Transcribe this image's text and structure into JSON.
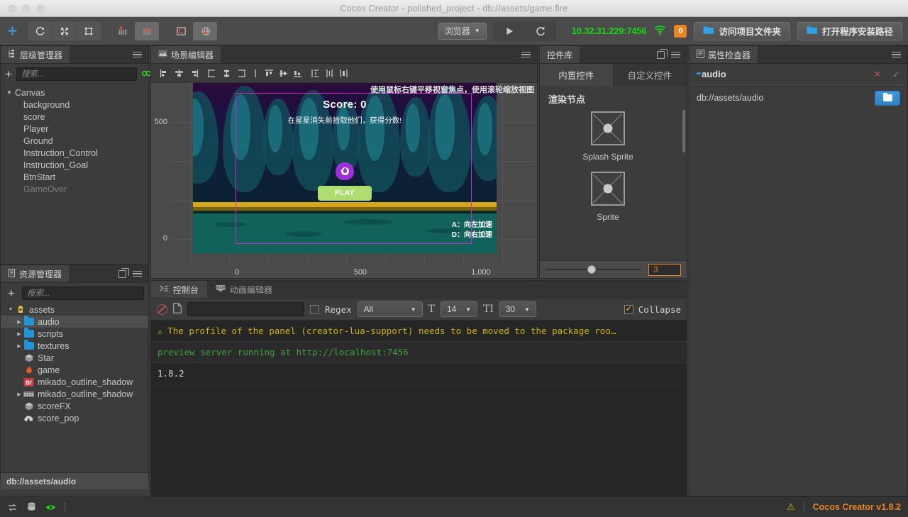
{
  "window": {
    "title": "Cocos Creator - polished_project - db://assets/game.fire"
  },
  "toolbar": {
    "tools": [
      {
        "name": "move-tool",
        "glyph": "✥"
      },
      {
        "name": "rotate-tool",
        "glyph": "⟳"
      },
      {
        "name": "scale-tool",
        "glyph": "✕"
      },
      {
        "name": "rect-tool",
        "glyph": "▣"
      }
    ],
    "view_tools": [
      {
        "name": "gizmo-position-tool",
        "glyph": "▦"
      },
      {
        "name": "gizmo-center-tool",
        "glyph": "✛"
      },
      {
        "name": "coord-local-tool",
        "glyph": "⌐"
      },
      {
        "name": "coord-global-tool",
        "glyph": "◍"
      }
    ],
    "browser_select": "浏览器",
    "browser_caret": "▼",
    "play_button": "▶",
    "refresh_button": "⟳",
    "ip_address": "10.32.31.229:7456",
    "wifi_icon": "wifi-icon",
    "notification_count": "0",
    "open_project_folder": "访问项目文件夹",
    "open_install_path": "打开程序安装路径"
  },
  "hierarchy": {
    "tab_label": "层级管理器",
    "search_placeholder": "搜索...",
    "root": "Canvas",
    "nodes": [
      {
        "label": "background",
        "dim": false
      },
      {
        "label": "score",
        "dim": false
      },
      {
        "label": "Player",
        "dim": false
      },
      {
        "label": "Ground",
        "dim": false
      },
      {
        "label": "Instruction_Control",
        "dim": false
      },
      {
        "label": "Instruction_Goal",
        "dim": false
      },
      {
        "label": "BtnStart",
        "dim": false
      },
      {
        "label": "GameOver",
        "dim": true
      }
    ]
  },
  "assets": {
    "tab_label": "资源管理器",
    "search_placeholder": "搜索...",
    "root": "assets",
    "items": [
      {
        "label": "audio",
        "icon": "folder",
        "arrow": "▶",
        "indent": 20,
        "selected": true
      },
      {
        "label": "scripts",
        "icon": "folder",
        "arrow": "▶",
        "indent": 20,
        "selected": false
      },
      {
        "label": "textures",
        "icon": "folder",
        "arrow": "▶",
        "indent": 20,
        "selected": false
      },
      {
        "label": "Star",
        "icon": "prefab",
        "arrow": "",
        "indent": 32,
        "selected": false
      },
      {
        "label": "game",
        "icon": "fire",
        "arrow": "",
        "indent": 32,
        "selected": false
      },
      {
        "label": "mikado_outline_shadow",
        "icon": "bitmap",
        "arrow": "",
        "indent": 32,
        "selected": false
      },
      {
        "label": "mikado_outline_shadow",
        "icon": "texture",
        "arrow": "▶",
        "indent": 20,
        "selected": false
      },
      {
        "label": "scoreFX",
        "icon": "prefab",
        "arrow": "",
        "indent": 32,
        "selected": false
      },
      {
        "label": "score_pop",
        "icon": "anim",
        "arrow": "",
        "indent": 32,
        "selected": false
      }
    ],
    "path_label": "db://assets/audio"
  },
  "scene": {
    "tab_label": "场景编辑器",
    "align_tools": [
      "align-left-icon",
      "align-hcenter-icon",
      "align-right-icon",
      "dist-left-icon",
      "dist-hcenter-icon",
      "dist-right-icon",
      "align-top-icon",
      "align-vcenter-icon",
      "align-bottom-icon",
      "dist-top-icon",
      "dist-vcenter-icon",
      "dist-bottom-icon"
    ],
    "hint": "使用鼠标右键平移视窗焦点，使用滚轮缩放视图",
    "ruler_y": [
      "500",
      "0"
    ],
    "ruler_x": [
      "0",
      "500",
      "1,000"
    ],
    "game": {
      "score_text": "Score: 0",
      "subtitle": "在星星消失前拾取他们，获得分数!",
      "play_label": "PLAY",
      "key_hint_1": "A：向左加速",
      "key_hint_2": "D：向右加速"
    }
  },
  "widgets": {
    "tab_label": "控件库",
    "tabs": [
      {
        "label": "内置控件",
        "active": true
      },
      {
        "label": "自定义控件",
        "active": false
      }
    ],
    "section": "渲染节点",
    "items": [
      {
        "label": "Splash Sprite"
      },
      {
        "label": "Sprite"
      }
    ],
    "zoom_value": "3"
  },
  "inspector": {
    "tab_label": "属性检查器",
    "asset_name": "audio",
    "discard_icon": "✕",
    "apply_icon": "✓",
    "path_value": "db://assets/audio",
    "browse_icon": "folder-open-icon"
  },
  "console": {
    "tabs": [
      {
        "label": "控制台",
        "icon": "console-icon",
        "active": true
      },
      {
        "label": "动画编辑器",
        "icon": "animation-icon",
        "active": false
      }
    ],
    "clear_icon": "clear-icon",
    "export_icon": "export-icon",
    "filter_value": "",
    "regex_label": "Regex",
    "level_select": "All",
    "font_size": "14",
    "line_height": "30",
    "collapse_label": "Collapse",
    "collapse_checked": true,
    "logs": [
      {
        "type": "warn",
        "icon": "⚠",
        "text": "The profile of the panel (creator-lua-support) needs to be moved to the package roo…"
      },
      {
        "type": "ok",
        "icon": "",
        "text": "preview server running at http://localhost:7456"
      },
      {
        "type": "plain",
        "icon": "",
        "text": "1.8.2"
      }
    ]
  },
  "statusbar": {
    "icons": [
      "sync-icon",
      "database-icon",
      "eye-icon"
    ],
    "warn_icon": "⚠",
    "version": "Cocos Creator v1.8.2"
  },
  "colors": {
    "accent_orange": "#e98523",
    "ip_green": "#19d619",
    "blue": "#2196d6",
    "selection_magenta": "#cc28cc"
  }
}
